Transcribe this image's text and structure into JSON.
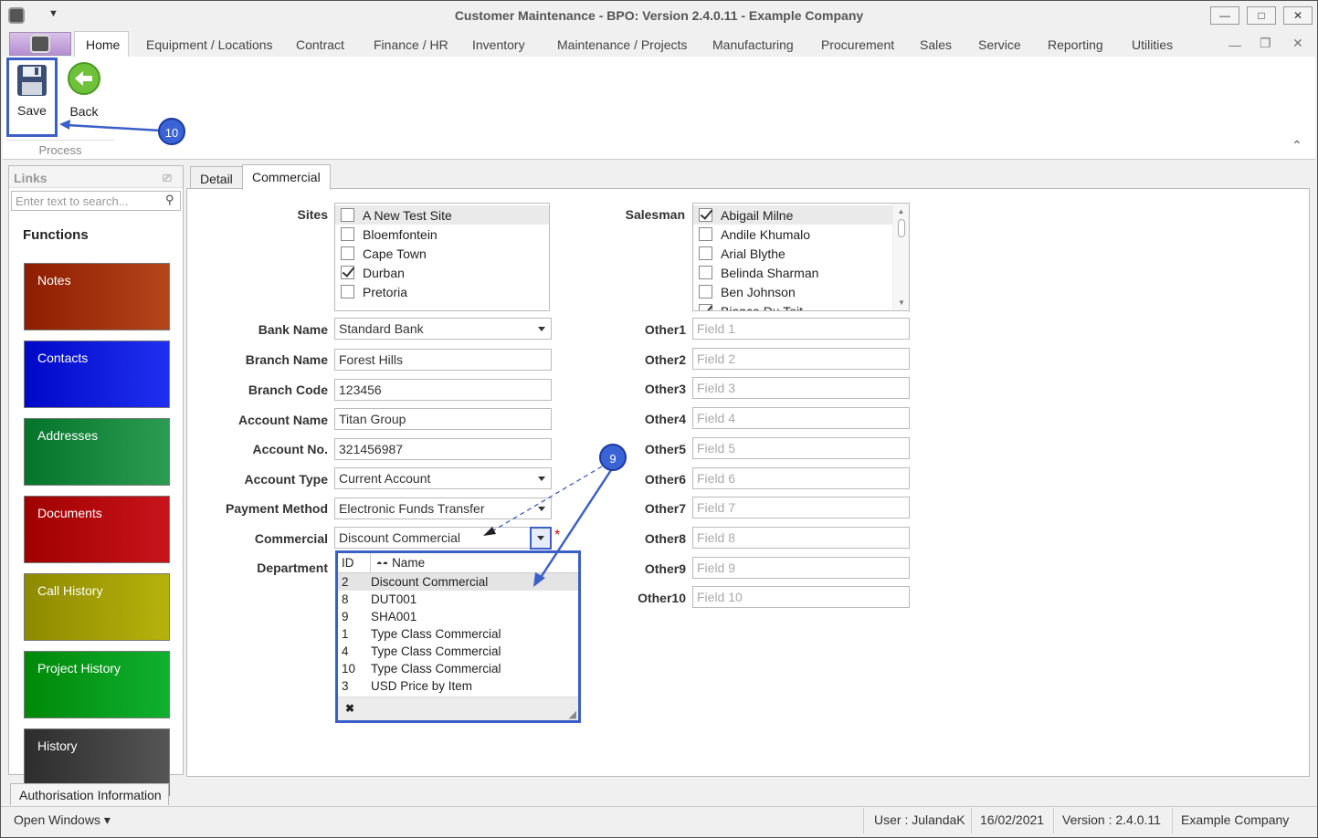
{
  "window": {
    "title": "Customer Maintenance - BPO: Version 2.4.0.11 - Example Company",
    "minimize": "—",
    "maximize": "□",
    "close": "✕"
  },
  "ribbon": {
    "tabs": [
      "Home",
      "Equipment / Locations",
      "Contract",
      "Finance / HR",
      "Inventory",
      "Maintenance / Projects",
      "Manufacturing",
      "Procurement",
      "Sales",
      "Service",
      "Reporting",
      "Utilities"
    ],
    "save_label": "Save",
    "back_label": "Back",
    "group_label": "Process"
  },
  "sidebar": {
    "title": "Links",
    "search_placeholder": "Enter text to search...",
    "functions_heading": "Functions",
    "buttons": [
      {
        "label": "Notes",
        "color": "#b5451b"
      },
      {
        "label": "Contacts",
        "color": "#2030f0"
      },
      {
        "label": "Addresses",
        "color": "#2c9c52"
      },
      {
        "label": "Documents",
        "color": "#c8141c"
      },
      {
        "label": "Call History",
        "color": "#b6b20c"
      },
      {
        "label": "Project History",
        "color": "#10b030"
      },
      {
        "label": "History",
        "color": "#555555"
      }
    ],
    "auth_tab": "Authorisation Information"
  },
  "tabs": [
    "Detail",
    "Commercial"
  ],
  "form": {
    "sites_label": "Sites",
    "sites": [
      {
        "name": "A New Test Site",
        "checked": false
      },
      {
        "name": "Bloemfontein",
        "checked": false
      },
      {
        "name": "Cape Town",
        "checked": false
      },
      {
        "name": "Durban",
        "checked": true
      },
      {
        "name": "Pretoria",
        "checked": false
      }
    ],
    "salesman_label": "Salesman",
    "salesmen": [
      {
        "name": "Abigail Milne",
        "checked": true
      },
      {
        "name": "Andile Khumalo",
        "checked": false
      },
      {
        "name": "Arial Blythe",
        "checked": false
      },
      {
        "name": "Belinda Sharman",
        "checked": false
      },
      {
        "name": "Ben Johnson",
        "checked": false
      },
      {
        "name": "Bianca Du Toit",
        "checked": true
      }
    ],
    "bank_name": {
      "label": "Bank Name",
      "value": "Standard Bank"
    },
    "branch_name": {
      "label": "Branch Name",
      "value": "Forest Hills"
    },
    "branch_code": {
      "label": "Branch Code",
      "value": "123456"
    },
    "account_name": {
      "label": "Account Name",
      "value": "Titan Group"
    },
    "account_no": {
      "label": "Account No.",
      "value": "321456987"
    },
    "account_type": {
      "label": "Account Type",
      "value": "Current Account"
    },
    "payment_method": {
      "label": "Payment Method",
      "value": "Electronic Funds Transfer"
    },
    "commercial": {
      "label": "Commercial",
      "value": "Discount Commercial",
      "required": "*"
    },
    "department": {
      "label": "Department"
    },
    "others": [
      {
        "label": "Other1",
        "placeholder": "Field 1"
      },
      {
        "label": "Other2",
        "placeholder": "Field 2"
      },
      {
        "label": "Other3",
        "placeholder": "Field 3"
      },
      {
        "label": "Other4",
        "placeholder": "Field 4"
      },
      {
        "label": "Other5",
        "placeholder": "Field 5"
      },
      {
        "label": "Other6",
        "placeholder": "Field 6"
      },
      {
        "label": "Other7",
        "placeholder": "Field 7"
      },
      {
        "label": "Other8",
        "placeholder": "Field 8"
      },
      {
        "label": "Other9",
        "placeholder": "Field 9"
      },
      {
        "label": "Other10",
        "placeholder": "Field 10"
      }
    ]
  },
  "popup": {
    "col_id": "ID",
    "col_name": "Name",
    "rows": [
      {
        "id": "2",
        "name": "Discount Commercial"
      },
      {
        "id": "8",
        "name": "DUT001"
      },
      {
        "id": "9",
        "name": "SHA001"
      },
      {
        "id": "1",
        "name": "Type Class Commercial"
      },
      {
        "id": "4",
        "name": "Type Class Commercial"
      },
      {
        "id": "10",
        "name": "Type Class Commercial"
      },
      {
        "id": "3",
        "name": "USD Price by Item"
      }
    ],
    "clear": "✖"
  },
  "callouts": {
    "save": "10",
    "commercial": "9"
  },
  "status": {
    "open_windows": "Open Windows ▾",
    "user": "User : JulandaK",
    "date": "16/02/2021",
    "version": "Version : 2.4.0.11",
    "company": "Example Company"
  }
}
